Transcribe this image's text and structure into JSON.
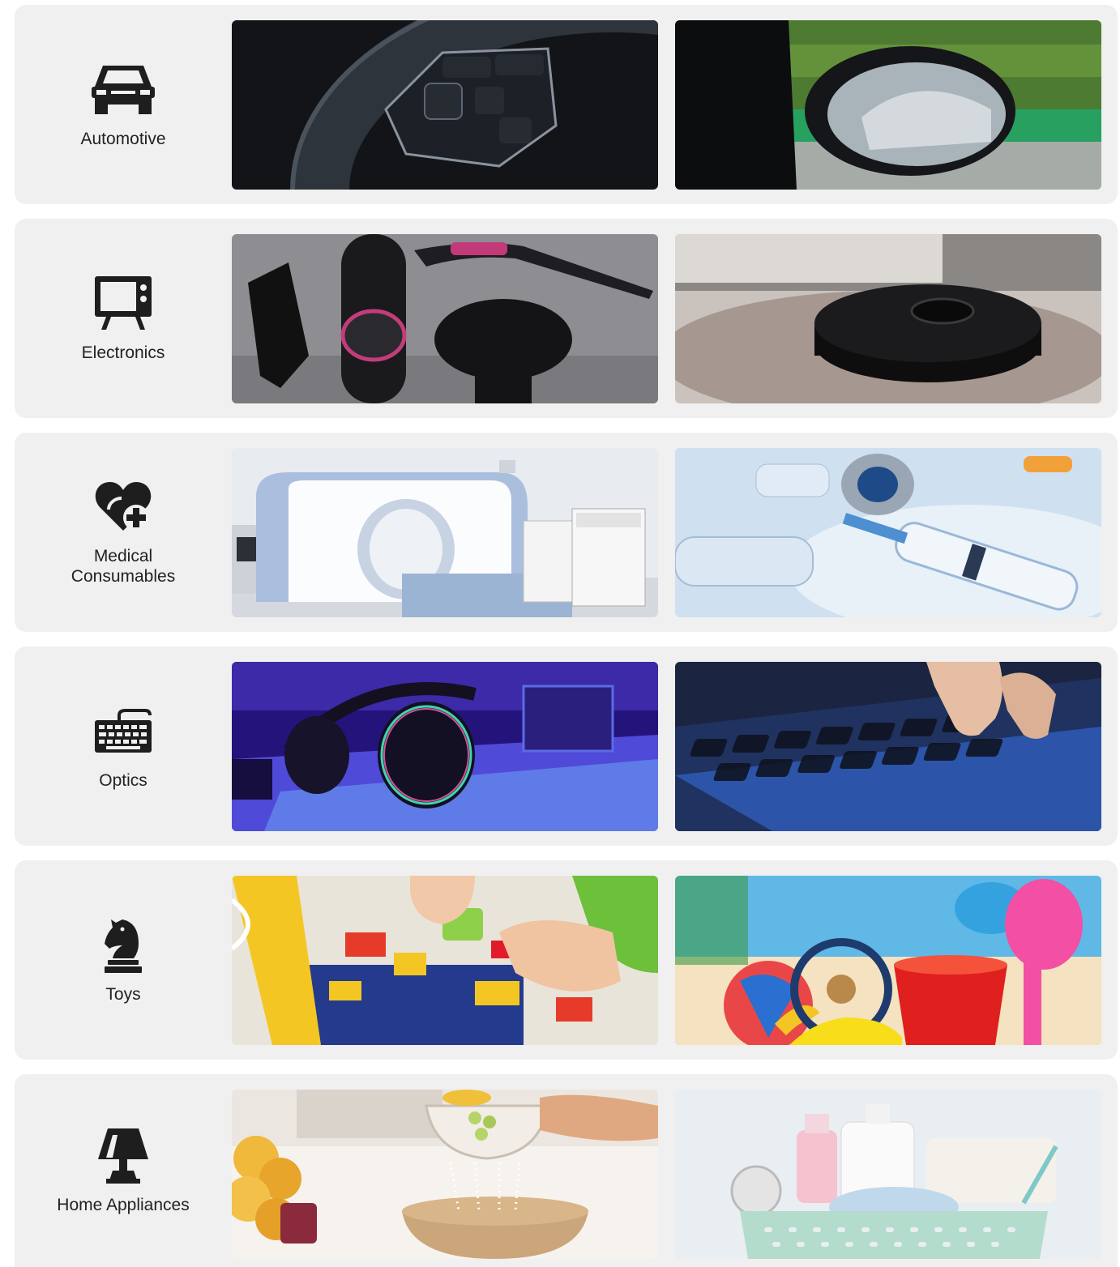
{
  "industries": [
    {
      "label": "Automotive",
      "icon": "car-icon",
      "photos": [
        {
          "name": "steering-wheel-controls-photo",
          "colors": [
            "#1b1e24",
            "#3b424c",
            "#7c8591"
          ]
        },
        {
          "name": "side-mirror-photo",
          "colors": [
            "#3c6b2d",
            "#111214",
            "#9aa6ae"
          ]
        }
      ]
    },
    {
      "label": "Electronics",
      "icon": "tv-icon",
      "photos": [
        {
          "name": "hair-dryer-attachments-photo",
          "colors": [
            "#8f8f93",
            "#1c1c1e",
            "#c23a78"
          ]
        },
        {
          "name": "robot-vacuum-photo",
          "colors": [
            "#a49893",
            "#121212",
            "#d8d2cc"
          ]
        }
      ]
    },
    {
      "label": "Medical\nConsumables",
      "icon": "heart-plus-icon",
      "photos": [
        {
          "name": "ct-scanner-photo",
          "colors": [
            "#e9ecf1",
            "#9eb6d6",
            "#ffffff"
          ]
        },
        {
          "name": "syringe-vials-photo",
          "colors": [
            "#cfe1f1",
            "#4f88c4",
            "#f2a13a"
          ]
        }
      ]
    },
    {
      "label": "Optics",
      "icon": "keyboard-icon",
      "photos": [
        {
          "name": "gaming-headset-photo",
          "colors": [
            "#27157a",
            "#6b46d8",
            "#3aa0f0"
          ]
        },
        {
          "name": "keyboard-typing-photo",
          "colors": [
            "#1a2338",
            "#3f6fd8",
            "#e9c3a8"
          ]
        }
      ]
    },
    {
      "label": "Toys",
      "icon": "chess-knight-icon",
      "photos": [
        {
          "name": "building-blocks-photo",
          "colors": [
            "#243a8c",
            "#f3c623",
            "#6cc03a"
          ]
        },
        {
          "name": "beach-toys-photo",
          "colors": [
            "#5fb8e6",
            "#e02424",
            "#f34fa4"
          ]
        }
      ]
    },
    {
      "label": "Home Appliances",
      "icon": "lamp-icon",
      "photos": [
        {
          "name": "kitchen-colander-photo",
          "colors": [
            "#f6f3ef",
            "#e8b13a",
            "#c9a576"
          ]
        },
        {
          "name": "bath-basket-photo",
          "colors": [
            "#e9eef2",
            "#a8d6c9",
            "#f1b9c8"
          ]
        }
      ]
    }
  ]
}
